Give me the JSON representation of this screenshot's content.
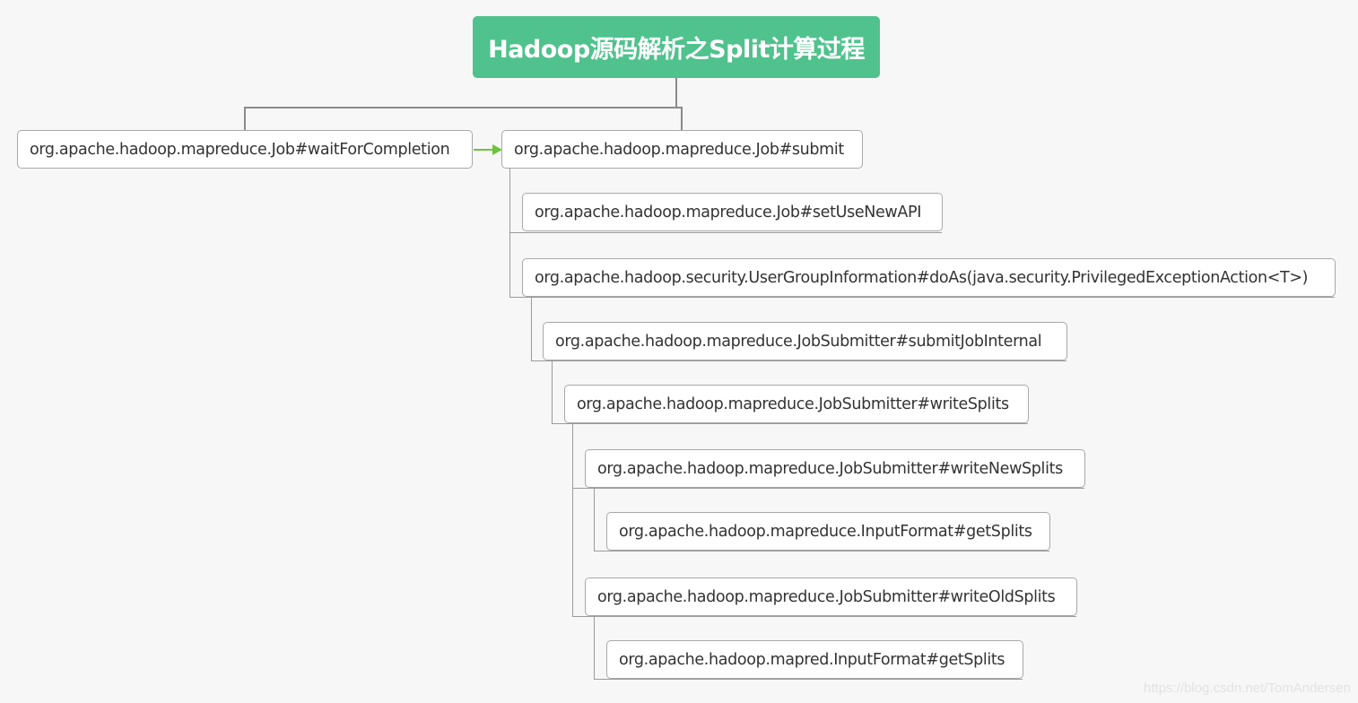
{
  "diagram": {
    "title": "Hadoop源码解析之Split计算过程",
    "nodes": [
      {
        "id": "n0",
        "label": "org.apache.hadoop.mapreduce.Job#waitForCompletion"
      },
      {
        "id": "n1",
        "label": "org.apache.hadoop.mapreduce.Job#submit"
      },
      {
        "id": "n2",
        "label": "org.apache.hadoop.mapreduce.Job#setUseNewAPI"
      },
      {
        "id": "n3",
        "label": "org.apache.hadoop.security.UserGroupInformation#doAs(java.security.PrivilegedExceptionAction<T>)"
      },
      {
        "id": "n4",
        "label": "org.apache.hadoop.mapreduce.JobSubmitter#submitJobInternal"
      },
      {
        "id": "n5",
        "label": "org.apache.hadoop.mapreduce.JobSubmitter#writeSplits"
      },
      {
        "id": "n6",
        "label": "org.apache.hadoop.mapreduce.JobSubmitter#writeNewSplits"
      },
      {
        "id": "n7",
        "label": "org.apache.hadoop.mapreduce.InputFormat#getSplits"
      },
      {
        "id": "n8",
        "label": "org.apache.hadoop.mapreduce.JobSubmitter#writeOldSplits"
      },
      {
        "id": "n9",
        "label": "org.apache.hadoop.mapred.InputFormat#getSplits"
      }
    ],
    "edges": [
      {
        "from": "title",
        "to": "n0",
        "type": "tree"
      },
      {
        "from": "title",
        "to": "n1",
        "type": "tree"
      },
      {
        "from": "n0",
        "to": "n1",
        "type": "arrow"
      },
      {
        "from": "n1",
        "to": "n2",
        "type": "tree"
      },
      {
        "from": "n1",
        "to": "n3",
        "type": "tree"
      },
      {
        "from": "n3",
        "to": "n4",
        "type": "tree"
      },
      {
        "from": "n4",
        "to": "n5",
        "type": "tree"
      },
      {
        "from": "n5",
        "to": "n6",
        "type": "tree"
      },
      {
        "from": "n6",
        "to": "n7",
        "type": "tree"
      },
      {
        "from": "n5",
        "to": "n8",
        "type": "tree"
      },
      {
        "from": "n8",
        "to": "n9",
        "type": "tree"
      }
    ],
    "colors": {
      "root_fill": "#50c28d",
      "arrow": "#6cc43a",
      "connector": "#8a8a8a"
    }
  },
  "watermark": "https://blog.csdn.net/TomAndersen"
}
